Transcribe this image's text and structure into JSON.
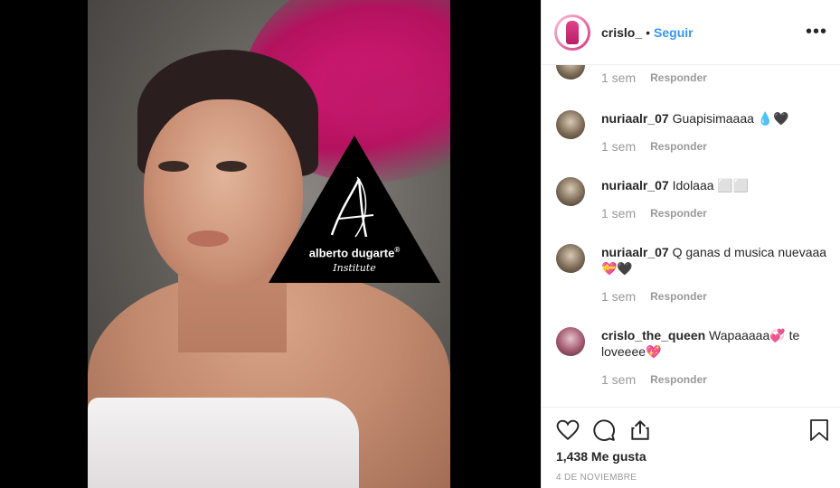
{
  "post": {
    "username": "crislo_",
    "separator": "•",
    "follow_label": "Seguir",
    "more_icon": "•••"
  },
  "image": {
    "logo_name": "alberto dugarte",
    "logo_registered": "®",
    "logo_subtitle": "Institute"
  },
  "comments": [
    {
      "user": "",
      "text": "",
      "time": "1 sem",
      "reply_label": "Responder"
    },
    {
      "user": "nuriaalr_07",
      "text": "Guapisimaaaa 💧🖤",
      "time": "1 sem",
      "reply_label": "Responder"
    },
    {
      "user": "nuriaalr_07",
      "text": "Idolaaa ⬜⬜",
      "time": "1 sem",
      "reply_label": "Responder"
    },
    {
      "user": "nuriaalr_07",
      "text": "Q ganas d musica nuevaaa 💝🖤",
      "time": "1 sem",
      "reply_label": "Responder"
    },
    {
      "user": "crislo_the_queen",
      "text": "Wapaaaaa💞 te loveeee💖",
      "time": "1 sem",
      "reply_label": "Responder"
    }
  ],
  "footer": {
    "likes": "1,438 Me gusta",
    "date": "4 DE NOVIEMBRE"
  },
  "colors": {
    "accent": "#3897f0",
    "muted": "#999999",
    "text": "#262626"
  }
}
